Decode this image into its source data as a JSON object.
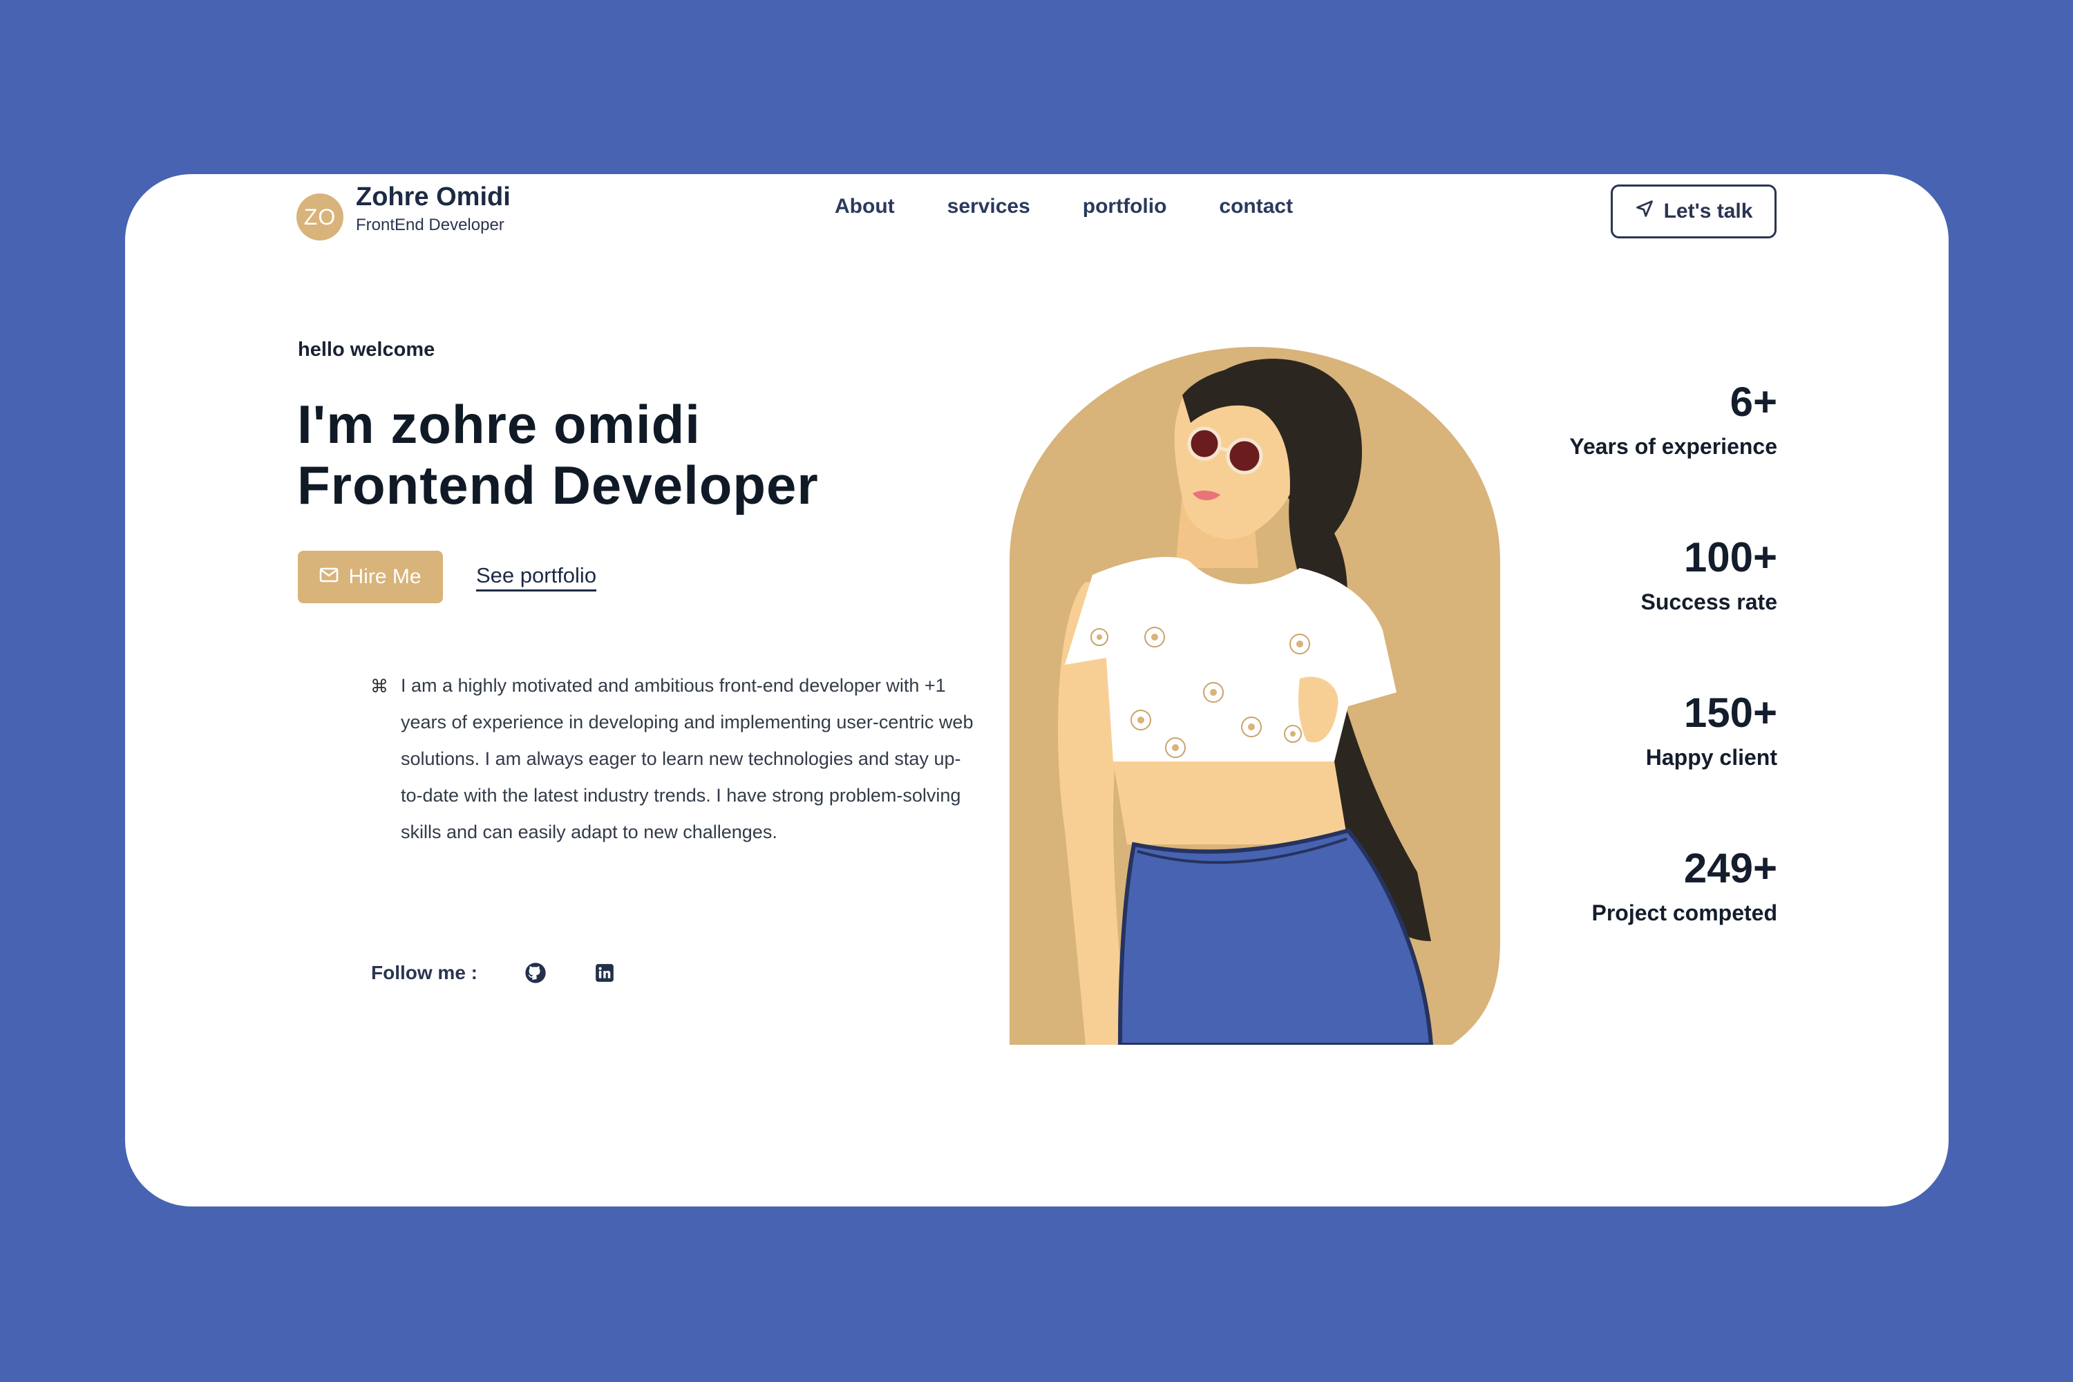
{
  "brand": {
    "initials": "ZO",
    "name": "Zohre Omidi",
    "role": "FrontEnd Developer"
  },
  "nav": {
    "items": [
      {
        "label": "About"
      },
      {
        "label": "services"
      },
      {
        "label": "portfolio"
      },
      {
        "label": "contact"
      }
    ],
    "cta_label": "Let's talk",
    "cta_icon": "send-icon"
  },
  "hero": {
    "greeting": "hello welcome",
    "headline_line1": "I'm zohre omidi",
    "headline_line2": "Frontend Developer",
    "hire_label": "Hire Me",
    "hire_icon": "mail-icon",
    "portfolio_label": "See portfolio",
    "bio_icon": "command-icon",
    "bio": "I am a highly motivated and ambitious front-end developer with +1 years of experience in developing and implementing user-centric web solutions. I am always eager to learn new technologies and stay up-to-date with the latest industry trends. I have strong problem-solving skills and can easily adapt to new challenges.",
    "follow_label": "Follow me :",
    "social": [
      {
        "icon": "github-icon"
      },
      {
        "icon": "linkedin-icon"
      }
    ]
  },
  "stats": [
    {
      "value": "6+",
      "label": "Years of experience"
    },
    {
      "value": "100+",
      "label": "Success rate"
    },
    {
      "value": "150+",
      "label": "Happy client"
    },
    {
      "value": "249+",
      "label": "Project competed"
    }
  ],
  "colors": {
    "page_bg": "#4763B2",
    "accent": "#D8B37A",
    "text_dark": "#141d2c",
    "skirt": "#4763B2"
  }
}
